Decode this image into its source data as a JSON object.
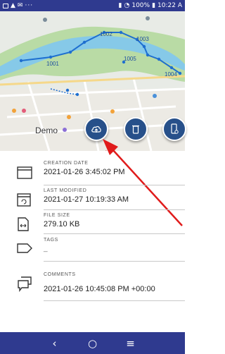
{
  "status_bar": {
    "left_icons": [
      "sim-icon",
      "alarm-icon",
      "mail-icon"
    ],
    "dots": "···",
    "battery": "100%",
    "time": "10:22 A"
  },
  "map": {
    "place_label": "Demo",
    "markers": [
      "1001",
      "1002",
      "1003",
      "1005",
      "1004"
    ]
  },
  "actions": {
    "upload_icon": "cloud-upload-icon",
    "delete_icon": "trash-icon",
    "phone_icon": "phone-settings-icon"
  },
  "details": {
    "creation_date": {
      "label": "CREATION DATE",
      "value": "2021-01-26 3:45:02 PM"
    },
    "last_modified": {
      "label": "LAST MODIFIED",
      "value": "2021-01-27 10:19:33 AM"
    },
    "file_size": {
      "label": "FILE SIZE",
      "value": "279.10 KB"
    },
    "tags": {
      "label": "TAGS",
      "value": "_"
    },
    "comments": {
      "label": "COMMENTS",
      "value": "2021-01-26 10:45:08 PM +00:00"
    }
  },
  "navbar": {
    "back": "‹",
    "home": "○",
    "menu": "≡"
  },
  "colors": {
    "bar": "#2f3a8f",
    "fab": "#27508a",
    "arrow": "#e01b1b",
    "track": "#1e6fd0"
  }
}
